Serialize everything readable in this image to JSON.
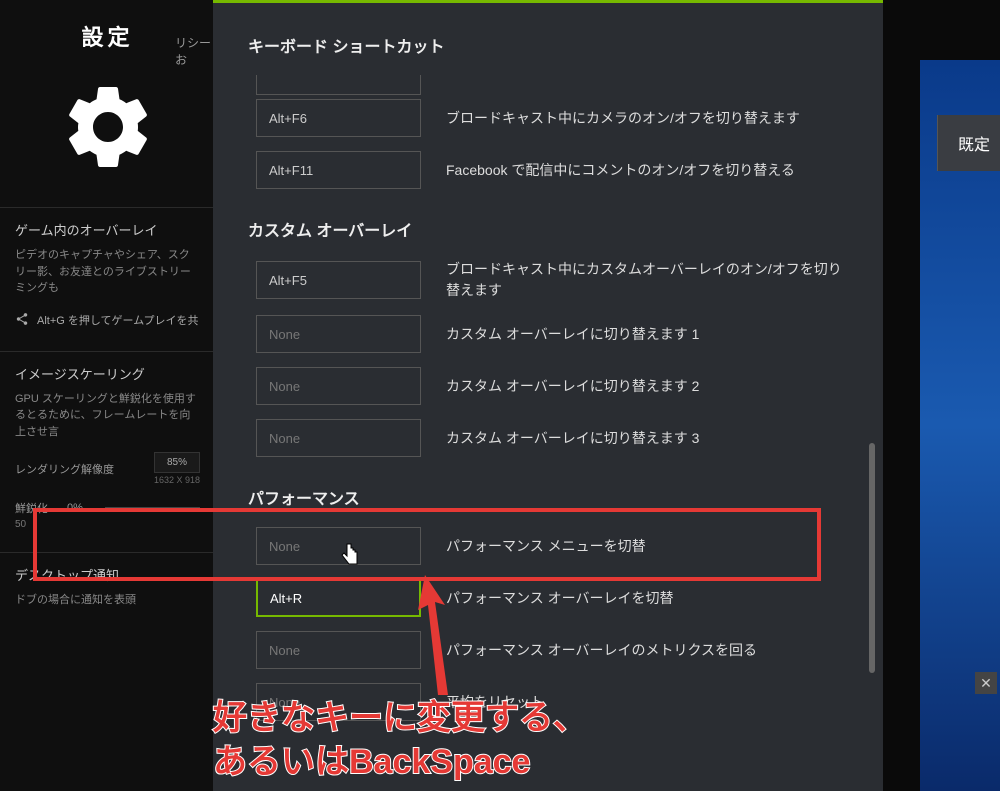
{
  "left": {
    "title": "設定",
    "policy": "リシーお",
    "overlay": {
      "title": "ゲーム内のオーバーレイ",
      "desc": "ピデオのキャプチャやシェア、スクリー影、お友達とのライブストリーミングも",
      "share": "Alt+G を押してゲームプレイを共"
    },
    "scaling": {
      "title": "イメージスケーリング",
      "desc": "GPU スケーリングと鮮鋭化を使用するとるために、フレームレートを向上させ言",
      "render_label": "レンダリング解像度",
      "render_pct": "85%",
      "render_res": "1632 X 918",
      "sharpen_label": "鮮鋭化",
      "sharpen_pct": "0%",
      "sharpen_val": "50"
    },
    "desktop": {
      "title": "デスクトップ通知",
      "desc": "ドブの場合に通知を表頭"
    }
  },
  "main": {
    "sections": {
      "keyboard": "キーボード ショートカット",
      "custom": "カスタム オーバーレイ",
      "performance": "パフォーマンス"
    },
    "rows": {
      "k1": {
        "key": "Alt+F6",
        "desc": "ブロードキャスト中にカメラのオン/オフを切り替えます"
      },
      "k2": {
        "key": "Alt+F11",
        "desc": "Facebook で配信中にコメントのオン/オフを切り替える"
      },
      "c1": {
        "key": "Alt+F5",
        "desc": "ブロードキャスト中にカスタムオーバーレイのオン/オフを切り替えます"
      },
      "c2": {
        "key": "None",
        "desc": "カスタム オーバーレイに切り替えます 1"
      },
      "c3": {
        "key": "None",
        "desc": "カスタム オーバーレイに切り替えます 2"
      },
      "c4": {
        "key": "None",
        "desc": "カスタム オーバーレイに切り替えます 3"
      },
      "p1": {
        "key": "None",
        "desc": "パフォーマンス メニューを切替"
      },
      "p2": {
        "key": "Alt+R",
        "desc": "パフォーマンス オーバーレイを切替"
      },
      "p3": {
        "key": "None",
        "desc": "パフォーマンス オーバーレイのメトリクスを回る"
      },
      "p4": {
        "key": "None",
        "desc": "平均をリセット"
      }
    }
  },
  "right": {
    "default": "既定"
  },
  "annotation": {
    "line1": "好きなキーに変更する、",
    "line2": "あるいはBackSpace"
  }
}
